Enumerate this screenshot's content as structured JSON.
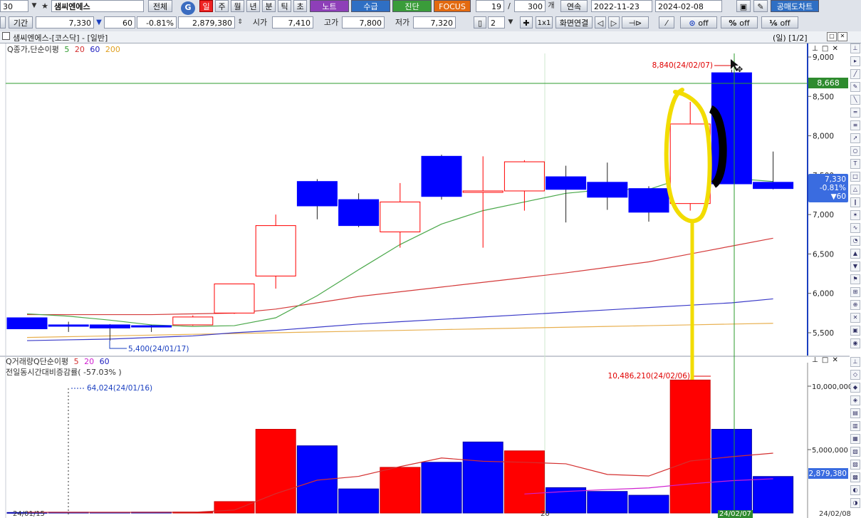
{
  "toolbar1": {
    "code": "30",
    "stock_name": "샘씨엔에스",
    "all_btn": "전체",
    "g_btn": "G",
    "periods": [
      "일",
      "주",
      "월",
      "년",
      "분",
      "틱",
      "초"
    ],
    "note_btn": "노트",
    "supply_btn": "수급",
    "diag_btn": "진단",
    "focus_btn": "FOCUS",
    "count": "19",
    "slash": "/",
    "total": "300",
    "unit": "개",
    "continuous_btn": "연속",
    "start_date": "2022-11-23",
    "end_date": "2024-02-08",
    "short_chart_btn": "공매도차트"
  },
  "toolbar2": {
    "period_label": "기간",
    "price": "7,330",
    "change": "60",
    "change_pct": "-0.81%",
    "volume": "2,879,380",
    "open_label": "시가",
    "open": "7,410",
    "high_label": "고가",
    "high": "7,800",
    "low_label": "저가",
    "low": "7,320",
    "split_count": "2",
    "ratio_btn": "1x1",
    "screen_link_btn": "화면연결",
    "g_off": "off",
    "pct_off": "off",
    "s_off": "off"
  },
  "title_bar": {
    "title": "샘씨엔에스-[코스닥] - [일반]",
    "page_info": "(일) [1/2]"
  },
  "legend_price": {
    "label": "Q종가,단순이평",
    "ma_periods": [
      "5",
      "20",
      "60",
      "200"
    ],
    "ma_colors": [
      "#2e9b2e",
      "#d43030",
      "#2020c0",
      "#e0a020"
    ]
  },
  "legend_volume": {
    "label": "Q거래량Q단순이평",
    "ma_periods": [
      "5",
      "20",
      "60"
    ],
    "ma_colors": [
      "#d43030",
      "#d020d0",
      "#2020c0"
    ],
    "sub_label": "전일동시간대비증감률( -57.03% )"
  },
  "colors": {
    "up": "#ff0000",
    "down": "#0000ff",
    "ma5": "#4aa84a",
    "ma20": "#d43a3a",
    "ma60": "#3a3ac8",
    "ma200": "#e8b050",
    "highlight": "#f2dc00"
  },
  "chart_data": [
    {
      "type": "candlestick",
      "title": "",
      "y_ticks": [
        "9,000",
        "8,500",
        "8,000",
        "7,500",
        "7,000",
        "6,500",
        "6,000",
        "5,500"
      ],
      "ylim": [
        5400,
        9100
      ],
      "candles": [
        {
          "o": 5690,
          "c": 5550,
          "h": 5690,
          "l": 5550
        },
        {
          "o": 5600,
          "c": 5590,
          "h": 5640,
          "l": 5510
        },
        {
          "o": 5600,
          "c": 5560,
          "h": 5610,
          "l": 5400
        },
        {
          "o": 5590,
          "c": 5580,
          "h": 5600,
          "l": 5510
        },
        {
          "o": 5600,
          "c": 5700,
          "h": 5720,
          "l": 5590
        },
        {
          "o": 5750,
          "c": 6120,
          "h": 6120,
          "l": 5740
        },
        {
          "o": 6220,
          "c": 6860,
          "h": 7000,
          "l": 6060
        },
        {
          "o": 7420,
          "c": 7110,
          "h": 7450,
          "l": 6940
        },
        {
          "o": 7190,
          "c": 6860,
          "h": 7270,
          "l": 6840
        },
        {
          "o": 6780,
          "c": 7160,
          "h": 7400,
          "l": 6580
        },
        {
          "o": 7740,
          "c": 7230,
          "h": 7760,
          "l": 7190
        },
        {
          "o": 7300,
          "c": 7300,
          "h": 7740,
          "l": 6580
        },
        {
          "o": 7300,
          "c": 7670,
          "h": 7690,
          "l": 7050
        },
        {
          "o": 7480,
          "c": 7320,
          "h": 7620,
          "l": 6900
        },
        {
          "o": 7410,
          "c": 7220,
          "h": 7660,
          "l": 7060
        },
        {
          "o": 7330,
          "c": 7030,
          "h": 7360,
          "l": 6910
        },
        {
          "o": 7140,
          "c": 8150,
          "h": 8430,
          "l": 7050
        },
        {
          "o": 8800,
          "c": 7390,
          "h": 8840,
          "l": 7390
        },
        {
          "o": 7410,
          "c": 7330,
          "h": 7800,
          "l": 7320
        }
      ],
      "ma5": [
        5740,
        5710,
        5660,
        5600,
        5580,
        5590,
        5690,
        5970,
        6300,
        6620,
        6880,
        7050,
        7160,
        7270,
        7320,
        7320,
        7490,
        7460,
        7420
      ],
      "ma20": [
        5730,
        5730,
        5730,
        5730,
        5740,
        5750,
        5800,
        5880,
        5960,
        6020,
        6080,
        6140,
        6200,
        6260,
        6330,
        6400,
        6500,
        6600,
        6700
      ],
      "ma60": [
        5400,
        5410,
        5420,
        5440,
        5460,
        5500,
        5530,
        5570,
        5610,
        5640,
        5670,
        5700,
        5730,
        5760,
        5790,
        5820,
        5850,
        5880,
        5930
      ],
      "ma200": [
        5440,
        5450,
        5460,
        5470,
        5480,
        5490,
        5500,
        5510,
        5520,
        5530,
        5540,
        5550,
        5560,
        5570,
        5580,
        5590,
        5600,
        5610,
        5620
      ],
      "annotations": {
        "max": "8,840(24/02/07)",
        "min": "5,400(24/01/17)",
        "crosshair_price": "8,668",
        "current_price": "7,330",
        "current_pct": "-0.81%",
        "current_change": "▼60"
      }
    },
    {
      "type": "bar",
      "title": "",
      "y_ticks": [
        "10,000,000",
        "5,000,000"
      ],
      "ylim": [
        0,
        11500000
      ],
      "values": [
        40000,
        64024,
        60000,
        70000,
        80000,
        900000,
        6600000,
        5300000,
        1900000,
        3600000,
        4000000,
        5600000,
        4900000,
        2000000,
        1700000,
        1400000,
        10486210,
        6600000,
        2879380
      ],
      "up": [
        false,
        false,
        false,
        false,
        true,
        true,
        true,
        false,
        false,
        true,
        false,
        false,
        true,
        false,
        false,
        false,
        true,
        false,
        false
      ],
      "ma5": [
        60000,
        58000,
        56000,
        55000,
        60000,
        230000,
        1530000,
        2590000,
        2890000,
        3660000,
        4340000,
        4080000,
        4000000,
        3880000,
        3040000,
        2920000,
        4100000,
        4440000,
        4720000
      ],
      "ma20": [
        null,
        null,
        null,
        null,
        null,
        null,
        null,
        null,
        null,
        null,
        null,
        null,
        1500000,
        1700000,
        1850000,
        1980000,
        2300000,
        2550000,
        2700000
      ],
      "annotations": {
        "max": "10,486,210(24/02/06)",
        "min": "64,024(24/01/16)",
        "current_volume": "2,879,380"
      }
    }
  ],
  "x_tick_labels": [
    "24/01/15",
    "20",
    "24/02/07",
    "24/02/08"
  ]
}
